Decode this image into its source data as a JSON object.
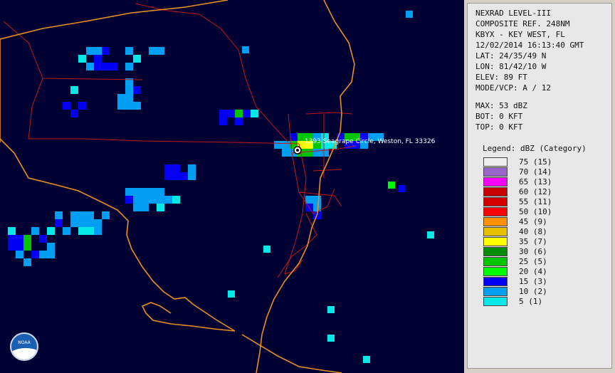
{
  "info_panel": {
    "lines": [
      "NEXRAD LEVEL-III",
      "COMPOSITE REF. 248NM",
      "KBYX - KEY WEST, FL",
      "12/02/2014 16:13:40 GMT",
      "LAT: 24/35/49 N",
      "LON: 81/42/10 W",
      "ELEV: 89 FT",
      "MODE/VCP: A / 12"
    ],
    "stats": [
      "MAX: 53 dBZ",
      "BOT: 0 KFT",
      "TOP: 0 KFT"
    ]
  },
  "legend": {
    "title": "Legend: dBZ (Category)",
    "items": [
      {
        "label": "75  (15)",
        "color": "#eeeeee"
      },
      {
        "label": "70  (14)",
        "color": "#9966cc"
      },
      {
        "label": "65  (13)",
        "color": "#ff00ff"
      },
      {
        "label": "60  (12)",
        "color": "#c70000"
      },
      {
        "label": "55  (11)",
        "color": "#d40000"
      },
      {
        "label": "50  (10)",
        "color": "#ff0000"
      },
      {
        "label": "45  (9)",
        "color": "#ff9000"
      },
      {
        "label": "40  (8)",
        "color": "#e7c000"
      },
      {
        "label": "35  (7)",
        "color": "#ffff00"
      },
      {
        "label": "30  (6)",
        "color": "#008e00"
      },
      {
        "label": "25  (5)",
        "color": "#01c501"
      },
      {
        "label": "20  (4)",
        "color": "#02fd02"
      },
      {
        "label": "15  (3)",
        "color": "#0300f4"
      },
      {
        "label": "10  (2)",
        "color": "#019ff4"
      },
      {
        "label": "5  (1)",
        "color": "#04e9e7"
      }
    ]
  },
  "map": {
    "pin_label": "1393 Seagrape Circle, Weston, FL 33326",
    "logo_text": "NOAA"
  }
}
